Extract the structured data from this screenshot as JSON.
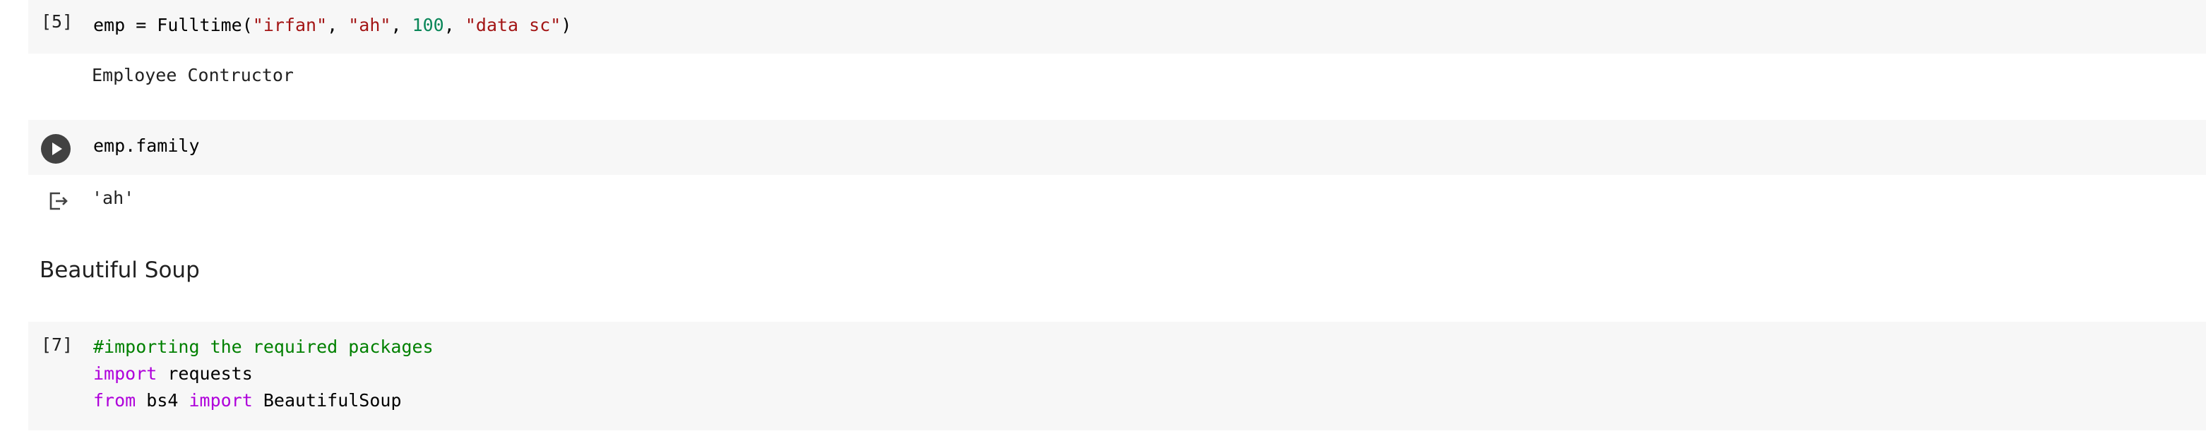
{
  "cells": {
    "cell5": {
      "exec_count": "[5]",
      "code": {
        "t1": "emp = Fulltime(",
        "t2": "\"irfan\"",
        "t3": ", ",
        "t4": "\"ah\"",
        "t5": ", ",
        "t6": "100",
        "t7": ", ",
        "t8": "\"data sc\"",
        "t9": ")"
      },
      "output": "Employee Contructor"
    },
    "cell6": {
      "code": "emp.family",
      "output": "'ah'",
      "run_icon": "play-icon",
      "output_icon": "output-arrow-icon"
    },
    "markdown": {
      "heading": "Beautiful Soup"
    },
    "cell7": {
      "exec_count": "[7]",
      "line1": "#importing the required packages",
      "line2": {
        "kw": "import",
        "rest": " requests"
      },
      "line3": {
        "kw1": "from",
        "mid": " bs4 ",
        "kw2": "import",
        "rest": " BeautifulSoup"
      }
    }
  },
  "colors": {
    "cell_bg": "#f7f7f7",
    "string": "#a31515",
    "number": "#098658",
    "keyword": "#af00db",
    "comment": "#008000"
  }
}
